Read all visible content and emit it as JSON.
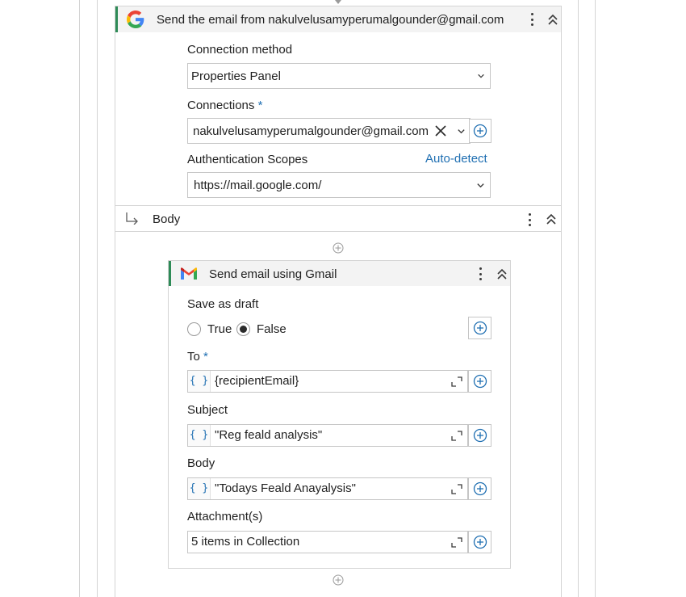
{
  "outer_activity": {
    "title": "Send the email from nakulvelusamyperumalgounder@gmail.com",
    "connection_method_label": "Connection method",
    "connection_method_value": "Properties Panel",
    "connections_label": "Connections",
    "required_marker": "*",
    "connections_value": "nakulvelusamyperumalgounder@gmail.com",
    "auth_scopes_label": "Authentication Scopes",
    "auto_detect_label": "Auto-detect",
    "auth_scopes_value": "https://mail.google.com/"
  },
  "body_section": {
    "label": "Body"
  },
  "inner_activity": {
    "title": "Send email using Gmail",
    "save_as_draft_label": "Save as draft",
    "true_label": "True",
    "false_label": "False",
    "selected": "False",
    "to_label": "To",
    "to_value": "{recipientEmail}",
    "subject_label": "Subject",
    "subject_value": "\"Reg feald analysis\"",
    "body_label": "Body",
    "body_value": "\"Todays Feald Anayalysis\"",
    "attachments_label": "Attachment(s)",
    "attachments_value": "5 items in Collection",
    "braces_glyph": "{ }"
  },
  "colors": {
    "accent": "#1f6fb2",
    "activity_bar": "#2e8b57",
    "header_bg": "#f3f3f3",
    "border": "#c6c6c6"
  },
  "icons": [
    "google-logo-icon",
    "gmail-logo-icon",
    "kebab-menu-icon",
    "collapse-icon",
    "chevron-down-icon",
    "clear-x-icon",
    "plus-circle-icon",
    "expand-icon",
    "branch-arrow-icon"
  ]
}
